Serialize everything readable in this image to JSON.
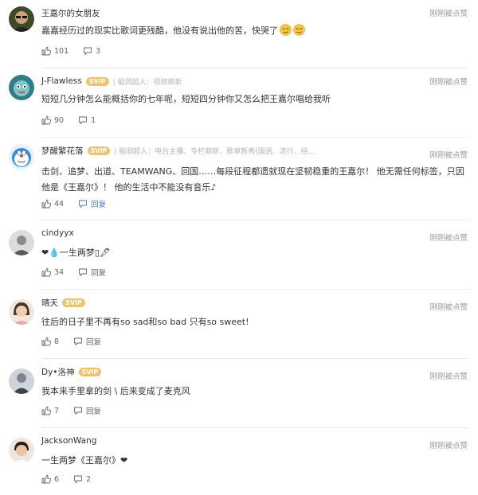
{
  "comments": [
    {
      "name": "王嘉尔的女朋友",
      "svip": "",
      "tags": "",
      "time": "刚刚被点赞",
      "text": "嘉嘉经历过的现实比歌词更残酷，他没有说出他的苦，快哭了",
      "likes": "101",
      "replies": "3",
      "avatar_icon": "sunglasses-avatar-icon"
    },
    {
      "name": "J-Flawless",
      "svip": "SVIP",
      "tags": "| 脑洞超人：视频萌新",
      "time": "刚刚被点赞",
      "text": "短短几分钟怎么能概括你的七年呢，短短四分钟你又怎么把王嘉尔唱给我听",
      "likes": "90",
      "replies": "1",
      "avatar_icon": "cartoon-avatar-icon"
    },
    {
      "name": "梦醒繁花落",
      "svip": "SVIP",
      "tags": "| 脑洞超人：电台主播、专栏萌新、歌单新秀(国语、流行、经...",
      "time": "刚刚被点赞",
      "text": "击剑、追梦、出道、TEAMWANG、回国……每段征程都遗就现在坚韧稳重的王嘉尔！ 他无需任何标签，只因他是《王嘉尔》！ 他的生活中不能没有音乐♪",
      "likes": "44",
      "replies": "回复",
      "avatar_icon": "doraemon-avatar-icon"
    },
    {
      "name": "cindyyx",
      "svip": "",
      "tags": "",
      "time": "刚刚被点赞",
      "text": "❤💧一生两梦▯🖋",
      "likes": "34",
      "replies": "回复",
      "avatar_icon": "portrait-avatar-icon"
    },
    {
      "name": "晴天",
      "svip": "SVIP",
      "tags": "",
      "time": "刚刚被点赞",
      "text": "往后的日子里不再有so sad和so bad 只有so sweet!",
      "likes": "8",
      "replies": "回复",
      "avatar_icon": "girl-avatar-icon"
    },
    {
      "name": "Dy•洛神",
      "svip": "SVIP",
      "tags": "",
      "time": "刚刚被点赞",
      "text": "我本来手里拿的剑 \\ 后来变成了麦克风",
      "likes": "7",
      "replies": "回复",
      "avatar_icon": "person-avatar-icon"
    },
    {
      "name": "JacksonWang",
      "svip": "",
      "tags": "",
      "time": "刚刚被点赞",
      "text": "一生两梦《王嘉尔》❤",
      "likes": "6",
      "replies": "2",
      "avatar_icon": "face-avatar-icon"
    }
  ],
  "icons": {
    "like": "thumbs-up-icon",
    "comment": "speech-bubble-icon",
    "emoji": "smirk-emoji-icon"
  },
  "colors": {
    "reply_link": "#4d7bbd",
    "svip_badge": "#f0c36a",
    "divider": "#ececec"
  }
}
